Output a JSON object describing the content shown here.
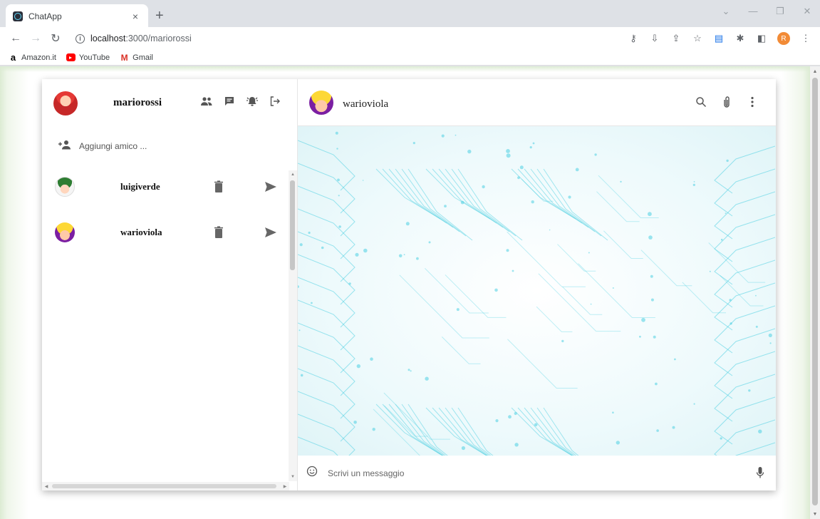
{
  "browser": {
    "tab_title": "ChatApp",
    "tab_close": "×",
    "new_tab": "+",
    "url_host": "localhost",
    "url_path": ":3000/mariorossi",
    "bookmarks": [
      {
        "label": "Amazon.it",
        "icon": "amazon-icon"
      },
      {
        "label": "YouTube",
        "icon": "youtube-icon"
      },
      {
        "label": "Gmail",
        "icon": "gmail-icon"
      }
    ],
    "profile_initial": "R"
  },
  "sidebar": {
    "username": "mariorossi",
    "add_friend_placeholder": "Aggiungi amico ...",
    "friends": [
      {
        "name": "luigiverde",
        "avatar": "luigi"
      },
      {
        "name": "warioviola",
        "avatar": "wario"
      }
    ]
  },
  "chat": {
    "contact_name": "warioviola",
    "message_placeholder": "Scrivi un messaggio"
  },
  "colors": {
    "icon": "#555555",
    "circuit": "#4dd0e1",
    "page_tint": "#dcebd3"
  }
}
